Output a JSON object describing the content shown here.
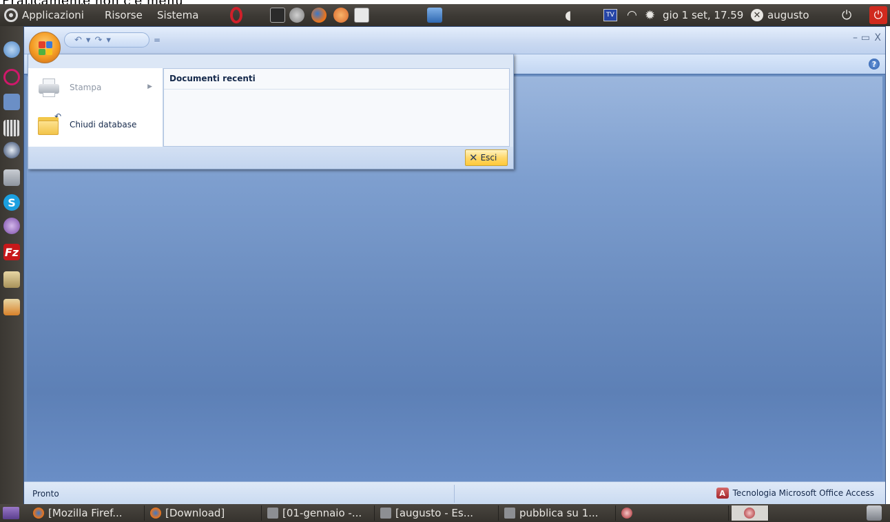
{
  "caption": "Praticamente non c'è menu",
  "top_panel": {
    "menus": [
      "Applicazioni",
      "Risorse",
      "Sistema"
    ],
    "clock": "gio 1 set, 17.59",
    "user": "augusto",
    "tv_label": "TV"
  },
  "window": {
    "qat_undo": "↶",
    "qat_redo": "↷",
    "qat_dropdown": "▾",
    "qat_customize": "=",
    "minimize": "–",
    "restore": "▭",
    "close": "X",
    "help": "?"
  },
  "office_menu": {
    "items": [
      {
        "label": "Stampa",
        "enabled": false,
        "has_submenu": true
      },
      {
        "label": "Chiudi database",
        "enabled": true,
        "has_submenu": false
      }
    ],
    "recent_title": "Documenti recenti",
    "exit_label": "Esci"
  },
  "status_bar": {
    "left": "Pronto",
    "right": "Tecnologia Microsoft Office Access"
  },
  "taskbar": {
    "tasks": [
      "[Mozilla Firef...",
      "[Download]",
      "[01-gennaio -...",
      "[augusto - Es...",
      "pubblica su 1..."
    ]
  },
  "colors": {
    "panel_bg": "#3c3934",
    "ribbon_bg": "#c2d6f2",
    "workspace_top": "#9bb6dd",
    "workspace_bottom": "#5d80b6",
    "office_button": "#f39a22",
    "exit_button": "#ffd86b"
  }
}
